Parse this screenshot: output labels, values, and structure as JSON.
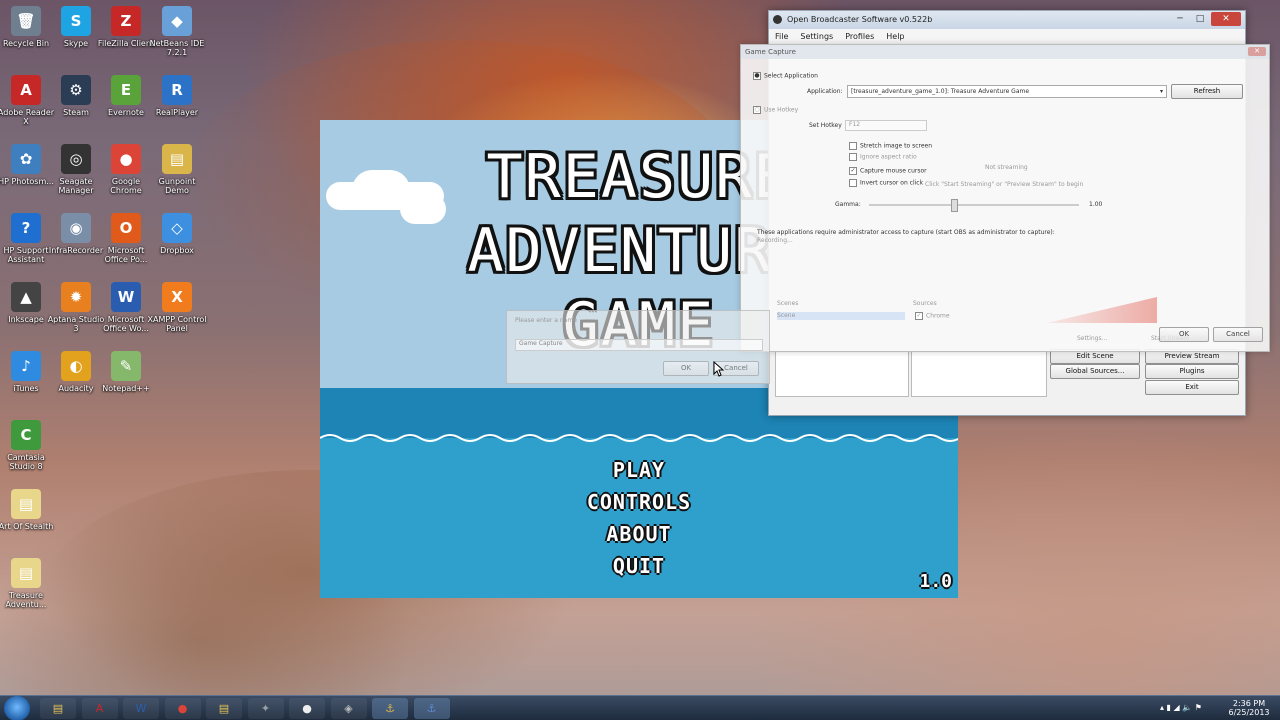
{
  "desktop_icons": [
    {
      "label": "Recycle Bin",
      "glyph": "🗑",
      "color": "#6f7f90"
    },
    {
      "label": "Skype",
      "glyph": "S",
      "color": "#1ea4e3"
    },
    {
      "label": "FileZilla Client",
      "glyph": "Z",
      "color": "#c62828"
    },
    {
      "label": "NetBeans IDE 7.2.1",
      "glyph": "◆",
      "color": "#6aa0d8"
    },
    {
      "label": "Adobe Reader X",
      "glyph": "A",
      "color": "#c62828"
    },
    {
      "label": "Steam",
      "glyph": "⚙",
      "color": "#2b3c55"
    },
    {
      "label": "Evernote",
      "glyph": "E",
      "color": "#5aa33b"
    },
    {
      "label": "RealPlayer",
      "glyph": "R",
      "color": "#2c72c6"
    },
    {
      "label": "HP Photosm...",
      "glyph": "✿",
      "color": "#3f7fc0"
    },
    {
      "label": "Seagate Manager",
      "glyph": "◎",
      "color": "#333333"
    },
    {
      "label": "Google Chrome",
      "glyph": "●",
      "color": "#db4437"
    },
    {
      "label": "Gunpoint Demo",
      "glyph": "▤",
      "color": "#d9b54a"
    },
    {
      "label": "HP Support Assistant",
      "glyph": "?",
      "color": "#1e6fd0"
    },
    {
      "label": "InfraRecorder",
      "glyph": "◉",
      "color": "#7a8ea8"
    },
    {
      "label": "Microsoft Office Po...",
      "glyph": "O",
      "color": "#e05a1b"
    },
    {
      "label": "Dropbox",
      "glyph": "◇",
      "color": "#3d8fe0"
    },
    {
      "label": "Inkscape",
      "glyph": "▲",
      "color": "#444444"
    },
    {
      "label": "Aptana Studio 3",
      "glyph": "✹",
      "color": "#e8801f"
    },
    {
      "label": "Microsoft Office Wo...",
      "glyph": "W",
      "color": "#2a5db0"
    },
    {
      "label": "XAMPP Control Panel",
      "glyph": "X",
      "color": "#f07c1e"
    },
    {
      "label": "iTunes",
      "glyph": "♪",
      "color": "#2e8be0"
    },
    {
      "label": "Audacity",
      "glyph": "◐",
      "color": "#e2a21d"
    },
    {
      "label": "Notepad++",
      "glyph": "✎",
      "color": "#85b86a"
    },
    {
      "label": "Camtasia Studio 8",
      "glyph": "C",
      "color": "#3e9a3c"
    },
    {
      "label": "Art Of Stealth",
      "glyph": "▤",
      "color": "#e8d68a"
    },
    {
      "label": "Treasure Adventu...",
      "glyph": "▤",
      "color": "#e8d68a"
    }
  ],
  "game": {
    "title_lines": [
      "TREASURE",
      "ADVENTURE",
      "GAME"
    ],
    "menu": [
      "PLAY",
      "CONTROLS",
      "ABOUT",
      "QUIT"
    ],
    "version": "1.0"
  },
  "obs": {
    "title": "Open Broadcaster Software v0.522b",
    "menu": [
      "File",
      "Settings",
      "Profiles",
      "Help"
    ],
    "buttons": {
      "preview_stream": "Preview Stream",
      "global_sources": "Global Sources...",
      "plugins": "Plugins",
      "exit": "Exit",
      "edit_scene": "Edit Scene"
    }
  },
  "game_capture": {
    "title": "Game Capture",
    "select_application": "Select Application",
    "application_label": "Application:",
    "application_value": "[treasure_adventure_game_1.0]: Treasure Adventure Game",
    "refresh": "Refresh",
    "use_hotkey": "Use Hotkey",
    "set_hotkey": "Set Hotkey",
    "hotkey_value": "F12",
    "stretch": "Stretch image to screen",
    "ignore_aspect": "Ignore aspect ratio",
    "capture_mouse": "Capture mouse cursor",
    "invert_cursor": "Invert cursor on click",
    "not_streaming": "Not streaming",
    "click_hint": "Click \"Start Streaming\" or \"Preview Stream\" to begin",
    "gamma_label": "Gamma:",
    "gamma_value": "1.00",
    "admin_note": "These applications require administrator access to capture (start OBS as administrator to capture):",
    "recording": "Recording...",
    "scenes": "Scenes",
    "sources": "Sources",
    "source_item": "Chrome",
    "scene_item": "Scene",
    "settings": "Settings...",
    "start_stream": "Start Stream",
    "ok": "OK",
    "cancel": "Cancel"
  },
  "name_dialog": {
    "prompt": "Please enter a name",
    "value": "Game Capture",
    "ok": "OK",
    "cancel": "Cancel"
  },
  "taskbar": {
    "time": "2:36 PM",
    "date": "6/25/2013",
    "items": [
      {
        "name": "explorer",
        "glyph": "▤",
        "color": "#e6c35a"
      },
      {
        "name": "adobe",
        "glyph": "A",
        "color": "#c62828"
      },
      {
        "name": "word",
        "glyph": "W",
        "color": "#2a5db0"
      },
      {
        "name": "chrome",
        "glyph": "●",
        "color": "#db4437"
      },
      {
        "name": "folder",
        "glyph": "▤",
        "color": "#e6c35a"
      },
      {
        "name": "pidgin",
        "glyph": "✦",
        "color": "#9aa0a8"
      },
      {
        "name": "obs",
        "glyph": "●",
        "color": "#eeeeee"
      },
      {
        "name": "app",
        "glyph": "◈",
        "color": "#bbbbbb"
      },
      {
        "name": "game",
        "glyph": "⚓",
        "color": "#d9b54a"
      },
      {
        "name": "game2",
        "glyph": "⚓",
        "color": "#5a8ad0"
      }
    ]
  }
}
